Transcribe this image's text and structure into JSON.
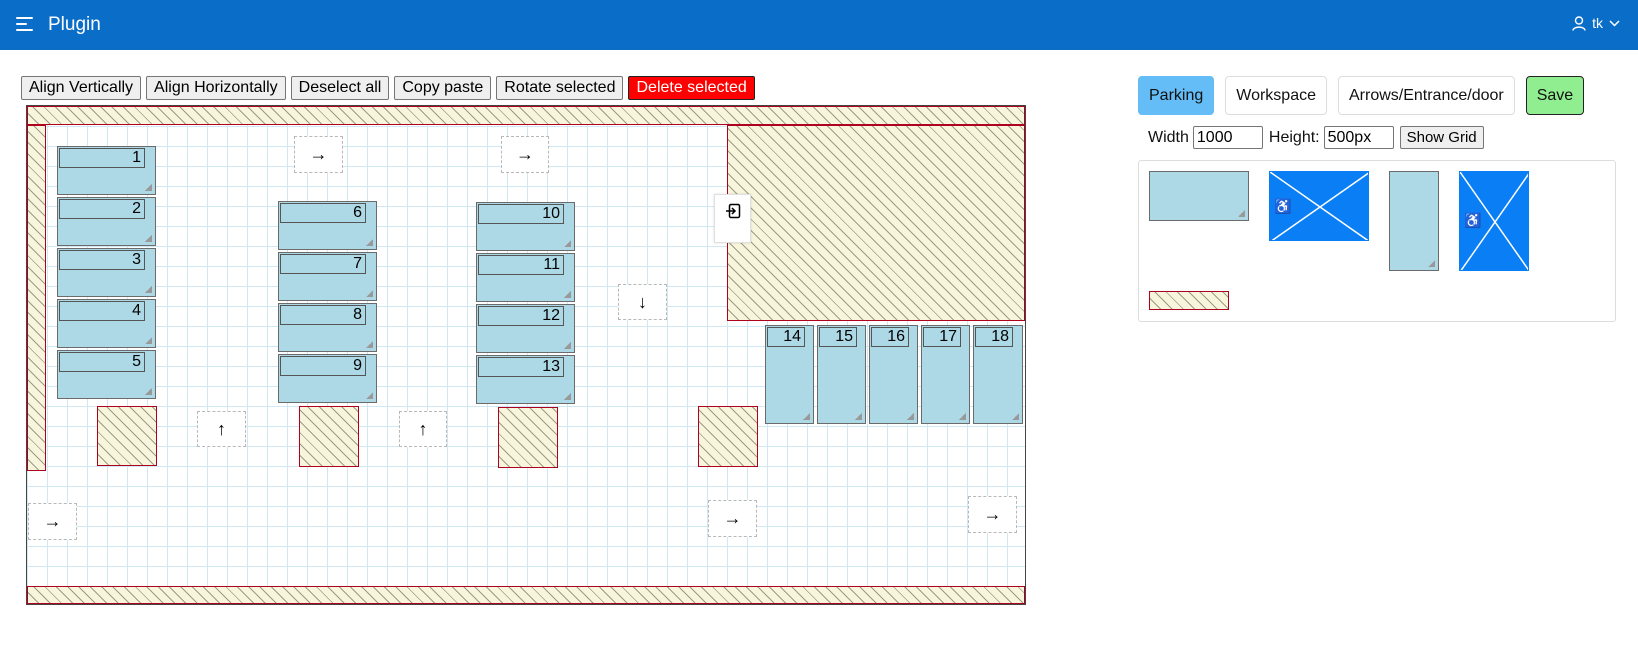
{
  "header": {
    "app_title": "Plugin",
    "user_name": "tk",
    "colors": {
      "bar": "#0a6ec9"
    }
  },
  "toolbar": {
    "align_vertically": "Align Vertically",
    "align_horizontally": "Align Horizontally",
    "deselect_all": "Deselect all",
    "copy_paste": "Copy paste",
    "rotate_selected": "Rotate selected",
    "delete_selected": "Delete selected"
  },
  "canvas": {
    "spots": [
      "1",
      "2",
      "3",
      "4",
      "5",
      "6",
      "7",
      "8",
      "9",
      "10",
      "11",
      "12",
      "13",
      "14",
      "15",
      "16",
      "17",
      "18"
    ],
    "arrows": [
      "right",
      "right",
      "up",
      "up",
      "down",
      "right",
      "right",
      "right"
    ],
    "entrance_icon": "door-enter-icon",
    "colors": {
      "spot": "#add8e6",
      "blocked": "#f7f5dc",
      "blocked_border": "#b00020",
      "grid": "#cfe8f3"
    }
  },
  "panel": {
    "tabs": [
      "Parking",
      "Workspace",
      "Arrows/Entrance/door"
    ],
    "active_tab": "Parking",
    "save_label": "Save",
    "width_label": "Width",
    "width_value": "1000",
    "height_label": "Height:",
    "height_value": "500px",
    "show_grid_label": "Show Grid",
    "palette_items": [
      "parking-spot-horizontal",
      "disabled-spot-horizontal",
      "parking-spot-vertical",
      "disabled-spot-vertical",
      "blocked-area"
    ],
    "colors": {
      "active_tab": "#64bdf7",
      "save": "#90ee90",
      "disabled_spot": "#0a7ff5",
      "delete": "#ff0000"
    }
  }
}
